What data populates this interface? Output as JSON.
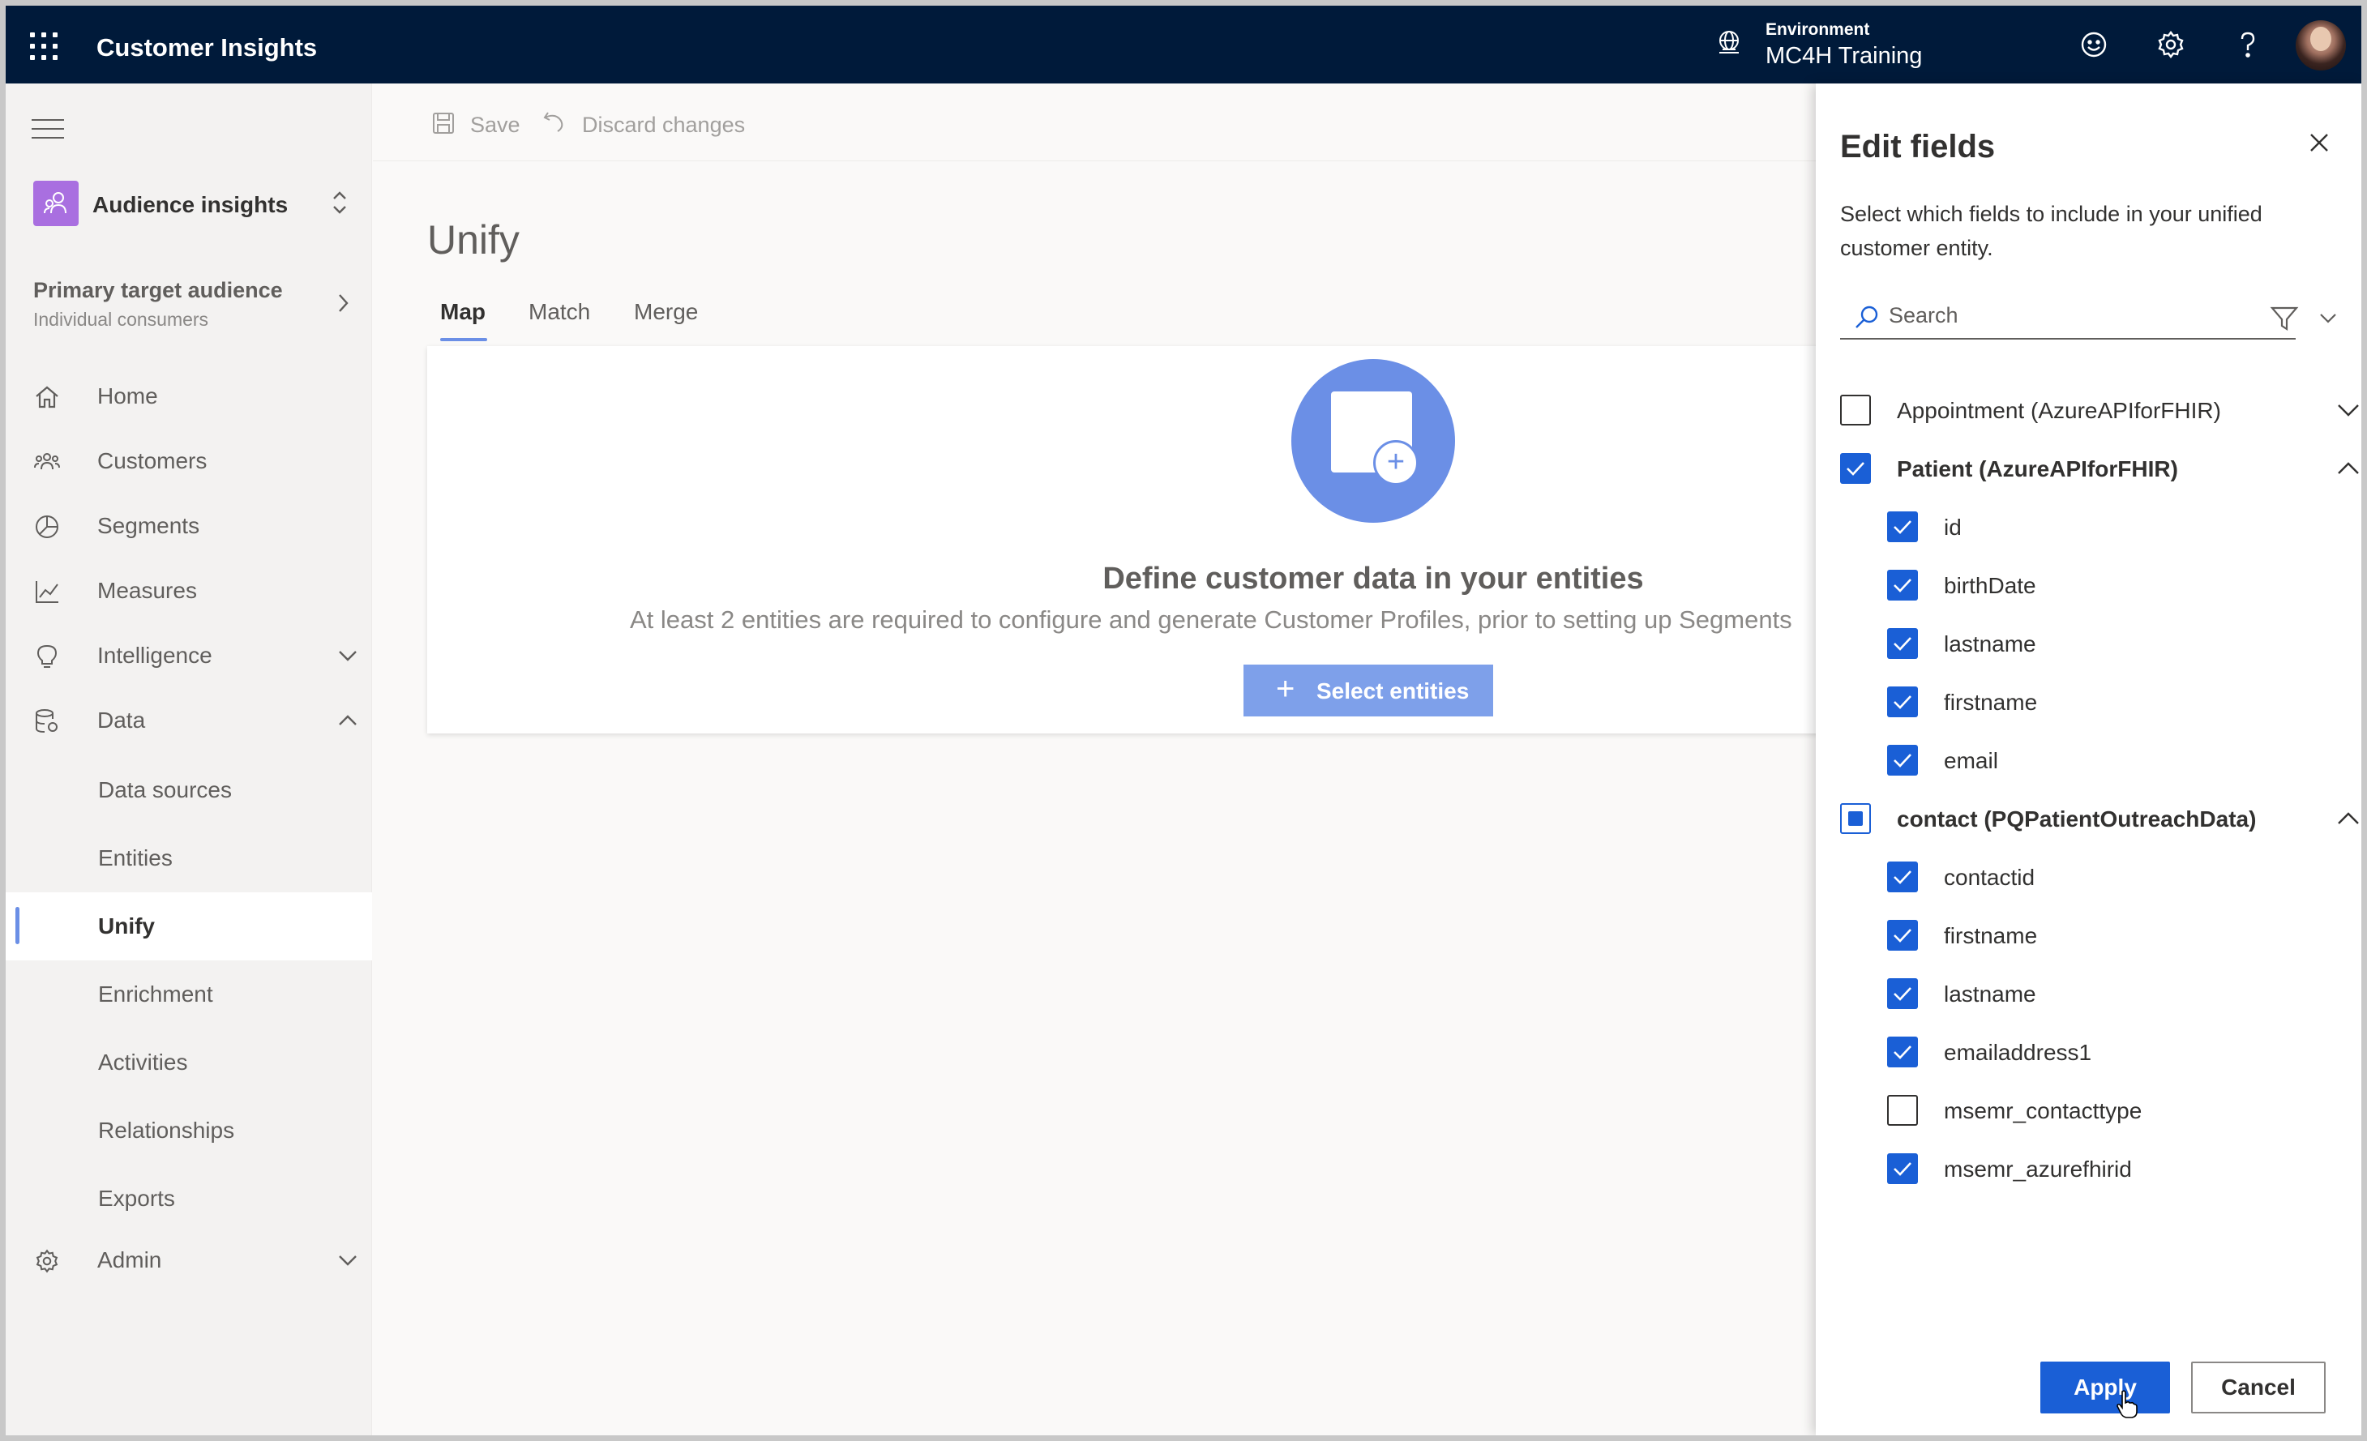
{
  "topbar": {
    "app_title": "Customer Insights",
    "environment_label": "Environment",
    "environment_name": "MC4H Training",
    "icons": [
      "waffle-icon",
      "environment-icon",
      "smiley-icon",
      "gear-icon",
      "help-icon",
      "avatar"
    ]
  },
  "leftnav": {
    "audience": "Audience insights",
    "primary_title": "Primary target audience",
    "primary_sub": "Individual consumers",
    "items": [
      {
        "label": "Home",
        "icon": "home-icon"
      },
      {
        "label": "Customers",
        "icon": "customers-icon"
      },
      {
        "label": "Segments",
        "icon": "segments-icon"
      },
      {
        "label": "Measures",
        "icon": "measures-icon"
      },
      {
        "label": "Intelligence",
        "icon": "lightbulb-icon"
      },
      {
        "label": "Data",
        "icon": "data-icon"
      },
      {
        "label": "Admin",
        "icon": "settings-icon"
      }
    ],
    "data_subitems": [
      "Data sources",
      "Entities",
      "Unify",
      "Enrichment",
      "Activities",
      "Relationships",
      "Exports"
    ],
    "selected_subitem": "Unify"
  },
  "commandbar": {
    "save": "Save",
    "discard": "Discard changes"
  },
  "main": {
    "title": "Unify",
    "tabs": [
      "Map",
      "Match",
      "Merge"
    ],
    "active_tab": "Map",
    "card": {
      "heading": "Define customer data in your entities",
      "description": "At least 2 entities are required to configure and generate Customer Profiles, prior to setting up Segments",
      "button": "Select entities"
    }
  },
  "panel": {
    "title": "Edit fields",
    "description": "Select which fields to include in your unified customer entity.",
    "search_placeholder": "Search",
    "groups": [
      {
        "name": "Appointment (AzureAPIforFHIR)",
        "state": "unchecked",
        "expanded": false,
        "fields": []
      },
      {
        "name": "Patient (AzureAPIforFHIR)",
        "state": "checked",
        "expanded": true,
        "fields": [
          {
            "name": "id",
            "checked": true
          },
          {
            "name": "birthDate",
            "checked": true
          },
          {
            "name": "lastname",
            "checked": true
          },
          {
            "name": "firstname",
            "checked": true
          },
          {
            "name": "email",
            "checked": true
          }
        ]
      },
      {
        "name": "contact (PQPatientOutreachData)",
        "state": "partial",
        "expanded": true,
        "fields": [
          {
            "name": "contactid",
            "checked": true
          },
          {
            "name": "firstname",
            "checked": true
          },
          {
            "name": "lastname",
            "checked": true
          },
          {
            "name": "emailaddress1",
            "checked": true
          },
          {
            "name": "msemr_contacttype",
            "checked": false
          },
          {
            "name": "msemr_azurefhirid",
            "checked": true
          }
        ]
      }
    ],
    "apply": "Apply",
    "cancel": "Cancel"
  },
  "colors": {
    "topbar": "#001a3a",
    "accent": "#1a5fd6",
    "accent_light": "#6b8fe6",
    "audience_tile": "#a96fe0"
  }
}
